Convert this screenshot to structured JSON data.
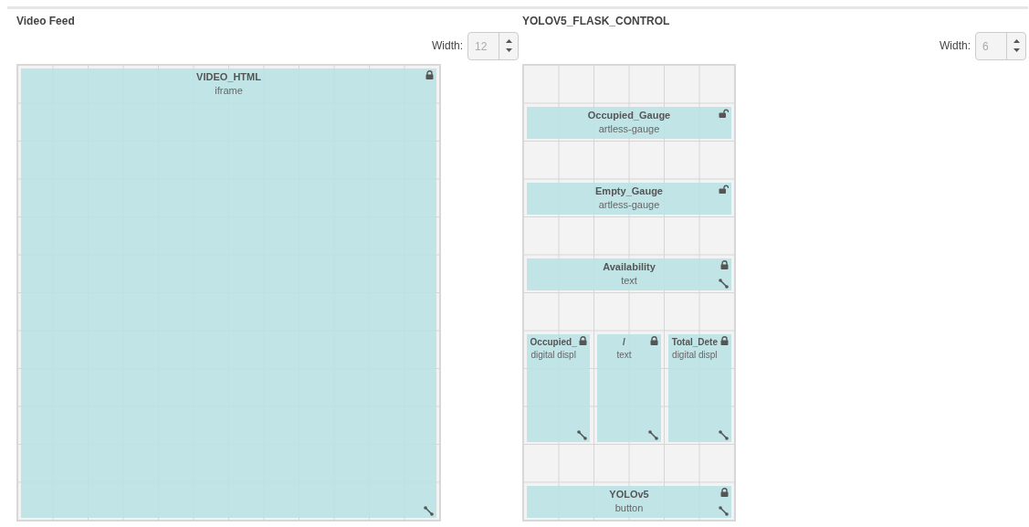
{
  "groups": [
    {
      "title": "Video Feed",
      "width_control": {
        "label": "Width:",
        "value": "12"
      },
      "rows": [
        {
          "kind": "full",
          "widgets": [
            {
              "name": "VIDEO_HTML",
              "type": "iframe",
              "locked": true
            }
          ]
        }
      ]
    },
    {
      "title": "YOLOV5_FLASK_CONTROL",
      "width_control": {
        "label": "Width:",
        "value": "6"
      },
      "rows": [
        {
          "kind": "blank"
        },
        {
          "kind": "band",
          "widgets": [
            {
              "name": "Occupied_Gauge",
              "type": "artless-gauge",
              "locked": false
            }
          ]
        },
        {
          "kind": "blank"
        },
        {
          "kind": "band",
          "widgets": [
            {
              "name": "Empty_Gauge",
              "type": "artless-gauge",
              "locked": false
            }
          ]
        },
        {
          "kind": "blank"
        },
        {
          "kind": "band",
          "widgets": [
            {
              "name": "Availability",
              "type": "text",
              "locked": true
            }
          ]
        },
        {
          "kind": "blank"
        },
        {
          "kind": "tall-split",
          "widgets": [
            {
              "name": "Occupied_",
              "type": "digital displ",
              "locked": true
            },
            {
              "name": "/",
              "type": "text",
              "locked": true
            },
            {
              "name": "Total_Dete",
              "type": "digital displ",
              "locked": true
            }
          ]
        },
        {
          "kind": "blank"
        },
        {
          "kind": "band",
          "widgets": [
            {
              "name": "YOLOv5",
              "type": "button",
              "locked": true
            }
          ]
        }
      ]
    }
  ]
}
